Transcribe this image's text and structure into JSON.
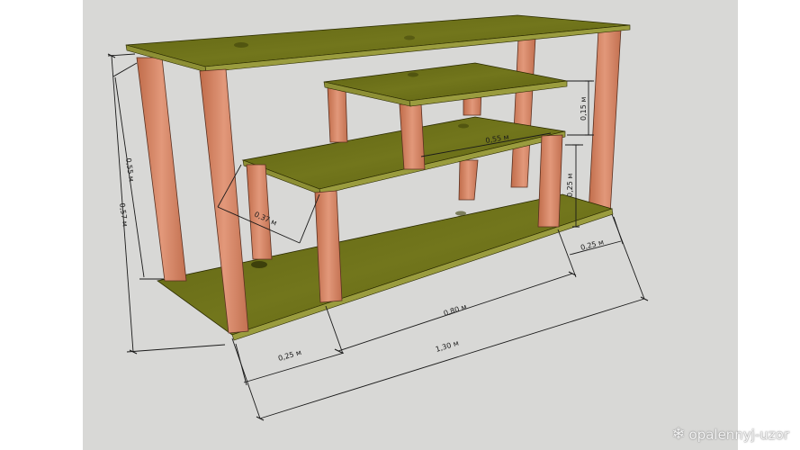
{
  "dimensions": {
    "upper_shelf_height": "0,15 м",
    "middle_shelf_height": "0,25 м",
    "right_side_depth": "0,25 м",
    "middle_shelf_length": "0,80 м",
    "total_length": "1,30 м",
    "left_section_width": "0,25 м",
    "upper_shelf_length": "0,55 м",
    "middle_shelf_depth": "0,37 м",
    "inner_height": "0,55 м",
    "total_height": "0,57 м"
  },
  "watermark": {
    "icon": "snowflake-icon",
    "text": "opalennyj-uzor"
  },
  "colors": {
    "background": "#d8d8d6",
    "board_top": "#6b6f18",
    "board_edge": "#9a9c3e",
    "leg": "#d88a68",
    "leg_shadow": "#a85a3c",
    "line": "#1a1a1a"
  }
}
